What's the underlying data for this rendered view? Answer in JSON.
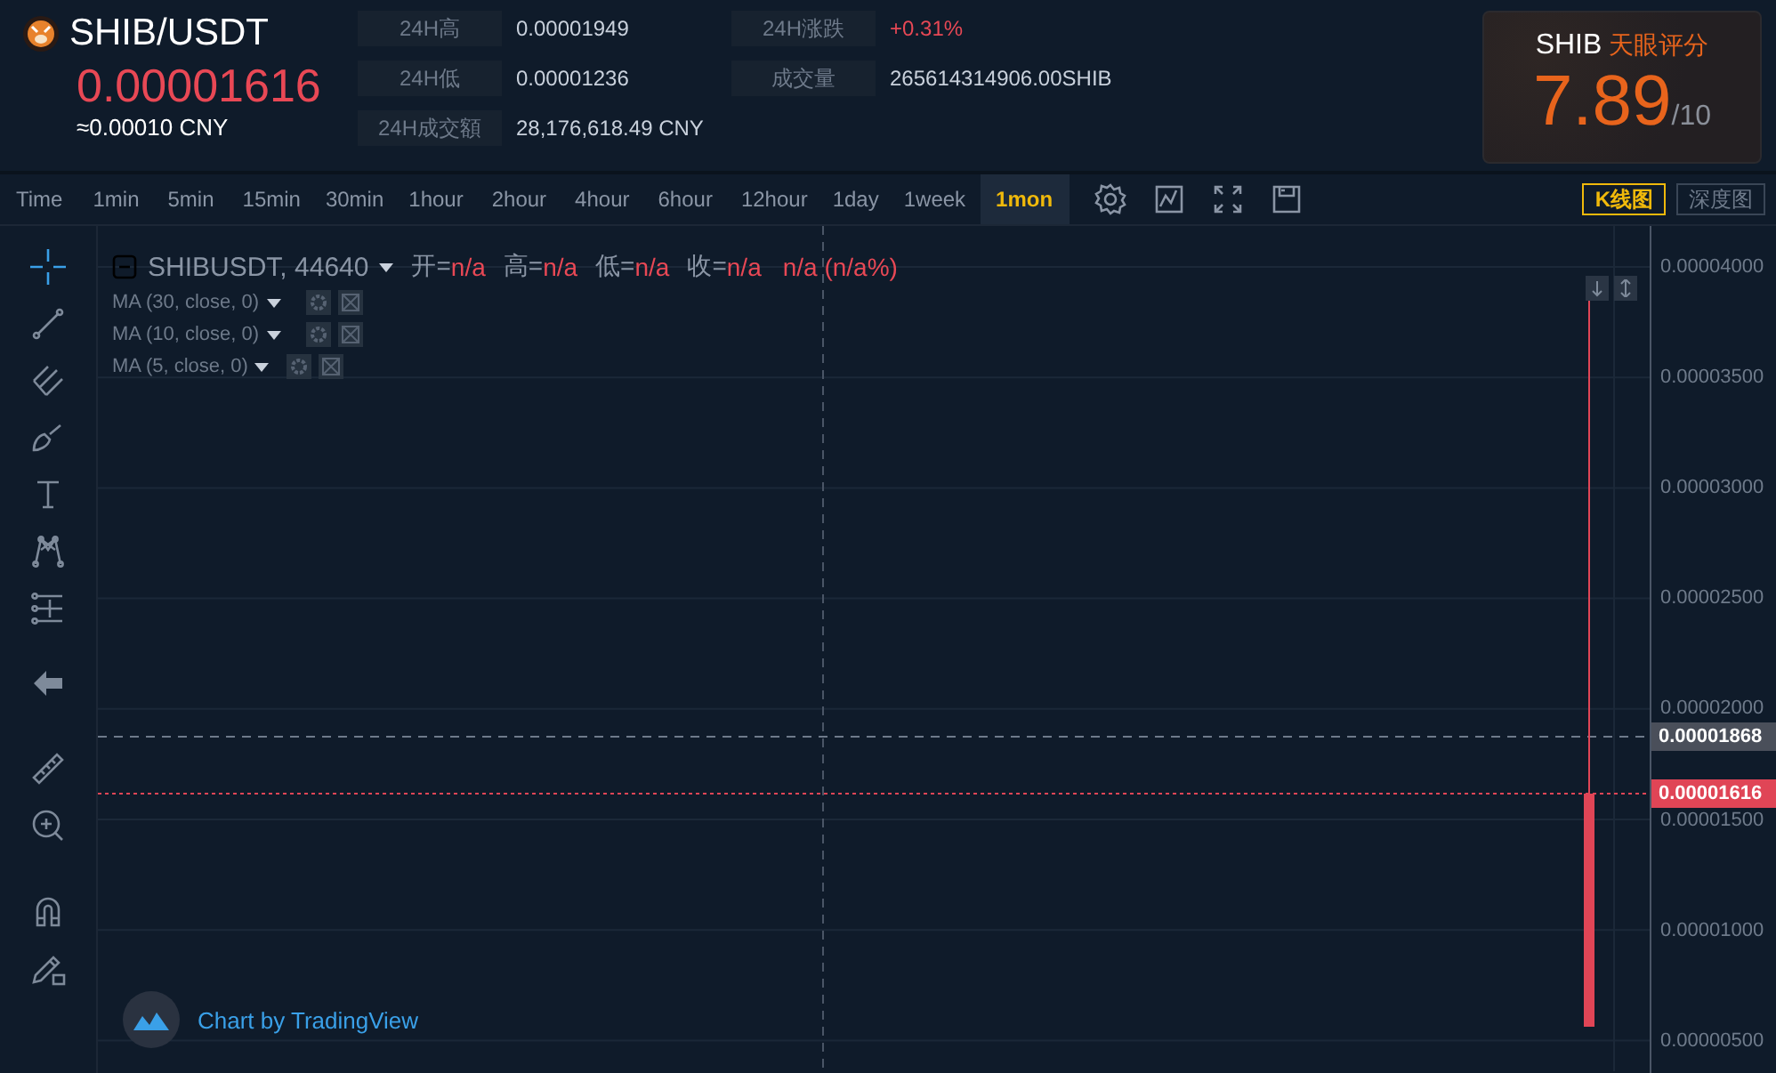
{
  "ticker": {
    "pair": "SHIB/USDT",
    "price": "0.00001616",
    "cny": "≈0.00010 CNY"
  },
  "stats": [
    {
      "label": "24H高",
      "value": "0.00001949",
      "color": "#c9d1dc"
    },
    {
      "label": "24H涨跌",
      "value": "+0.31%",
      "color": "#e84855"
    },
    {
      "label": "24H低",
      "value": "0.00001236",
      "color": "#c9d1dc"
    },
    {
      "label": "成交量",
      "value": "265614314906.00SHIB",
      "color": "#c9d1dc"
    },
    {
      "label": "24H成交額",
      "value": "28,176,618.49 CNY",
      "color": "#c9d1dc"
    }
  ],
  "rating": {
    "coin": "SHIB",
    "title": "天眼评分",
    "score": "7.89",
    "scale": "/10"
  },
  "intervals": [
    {
      "label": "Time",
      "selected": false
    },
    {
      "label": "1min",
      "selected": false
    },
    {
      "label": "5min",
      "selected": false
    },
    {
      "label": "15min",
      "selected": false
    },
    {
      "label": "30min",
      "selected": false
    },
    {
      "label": "1hour",
      "selected": false
    },
    {
      "label": "2hour",
      "selected": false
    },
    {
      "label": "4hour",
      "selected": false
    },
    {
      "label": "6hour",
      "selected": false
    },
    {
      "label": "12hour",
      "selected": false
    },
    {
      "label": "1day",
      "selected": false
    },
    {
      "label": "1week",
      "selected": false
    },
    {
      "label": "1mon",
      "selected": true
    }
  ],
  "views": [
    {
      "label": "K线图",
      "selected": true
    },
    {
      "label": "深度图",
      "selected": false
    }
  ],
  "legend": {
    "symbol": "SHIBUSDT, 44640",
    "ohlc": [
      {
        "label": "开=",
        "value": "n/a"
      },
      {
        "label": "高=",
        "value": "n/a"
      },
      {
        "label": "低=",
        "value": "n/a"
      },
      {
        "label": "收=",
        "value": "n/a"
      }
    ],
    "change": "n/a (n/a%)"
  },
  "indicators": [
    "MA (30, close, 0)",
    "MA (10, close, 0)",
    "MA (5, close, 0)"
  ],
  "price_axis": [
    "0.00004000",
    "0.00003500",
    "0.00003000",
    "0.00002500",
    "0.00002000",
    "0.00001500",
    "0.00001000",
    "0.00000500"
  ],
  "price_tags": [
    {
      "label": "0.00001868",
      "color": "#4a4f5a"
    },
    {
      "label": "0.00001616",
      "color": "#e04556"
    }
  ],
  "attribution": "Chart by TradingView"
}
